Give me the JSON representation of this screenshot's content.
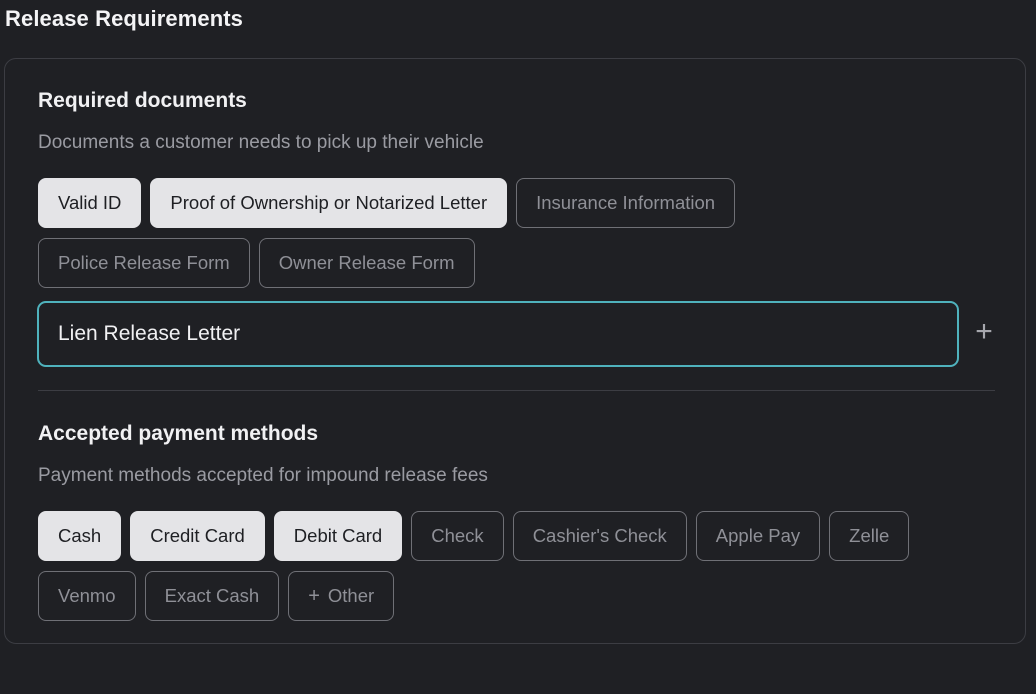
{
  "page": {
    "title": "Release Requirements"
  },
  "documents": {
    "title": "Required documents",
    "description": "Documents a customer needs to pick up their vehicle",
    "chips_row1": [
      {
        "label": "Valid ID",
        "selected": true
      },
      {
        "label": "Proof of Ownership or Notarized Letter",
        "selected": true
      },
      {
        "label": "Insurance Information",
        "selected": false
      }
    ],
    "chips_row2": [
      {
        "label": "Police Release Form",
        "selected": false
      },
      {
        "label": "Owner Release Form",
        "selected": false
      }
    ],
    "input": {
      "value": "Lien Release Letter",
      "placeholder": ""
    },
    "add_icon": "plus-icon"
  },
  "payments": {
    "title": "Accepted payment methods",
    "description": "Payment methods accepted for impound release fees",
    "chips_row1": [
      {
        "label": "Cash",
        "selected": true
      },
      {
        "label": "Credit Card",
        "selected": true
      },
      {
        "label": "Debit Card",
        "selected": true
      },
      {
        "label": "Check",
        "selected": false
      },
      {
        "label": "Cashier's Check",
        "selected": false
      },
      {
        "label": "Apple Pay",
        "selected": false
      },
      {
        "label": "Zelle",
        "selected": false
      }
    ],
    "chips_row2": [
      {
        "label": "Venmo",
        "selected": false
      },
      {
        "label": "Exact Cash",
        "selected": false
      },
      {
        "label": "Other",
        "selected": false,
        "icon": "plus-icon"
      }
    ]
  },
  "colors": {
    "background": "#1f2024",
    "selected_chip": "#e4e4e7",
    "focus_border": "#4fb2bd"
  }
}
